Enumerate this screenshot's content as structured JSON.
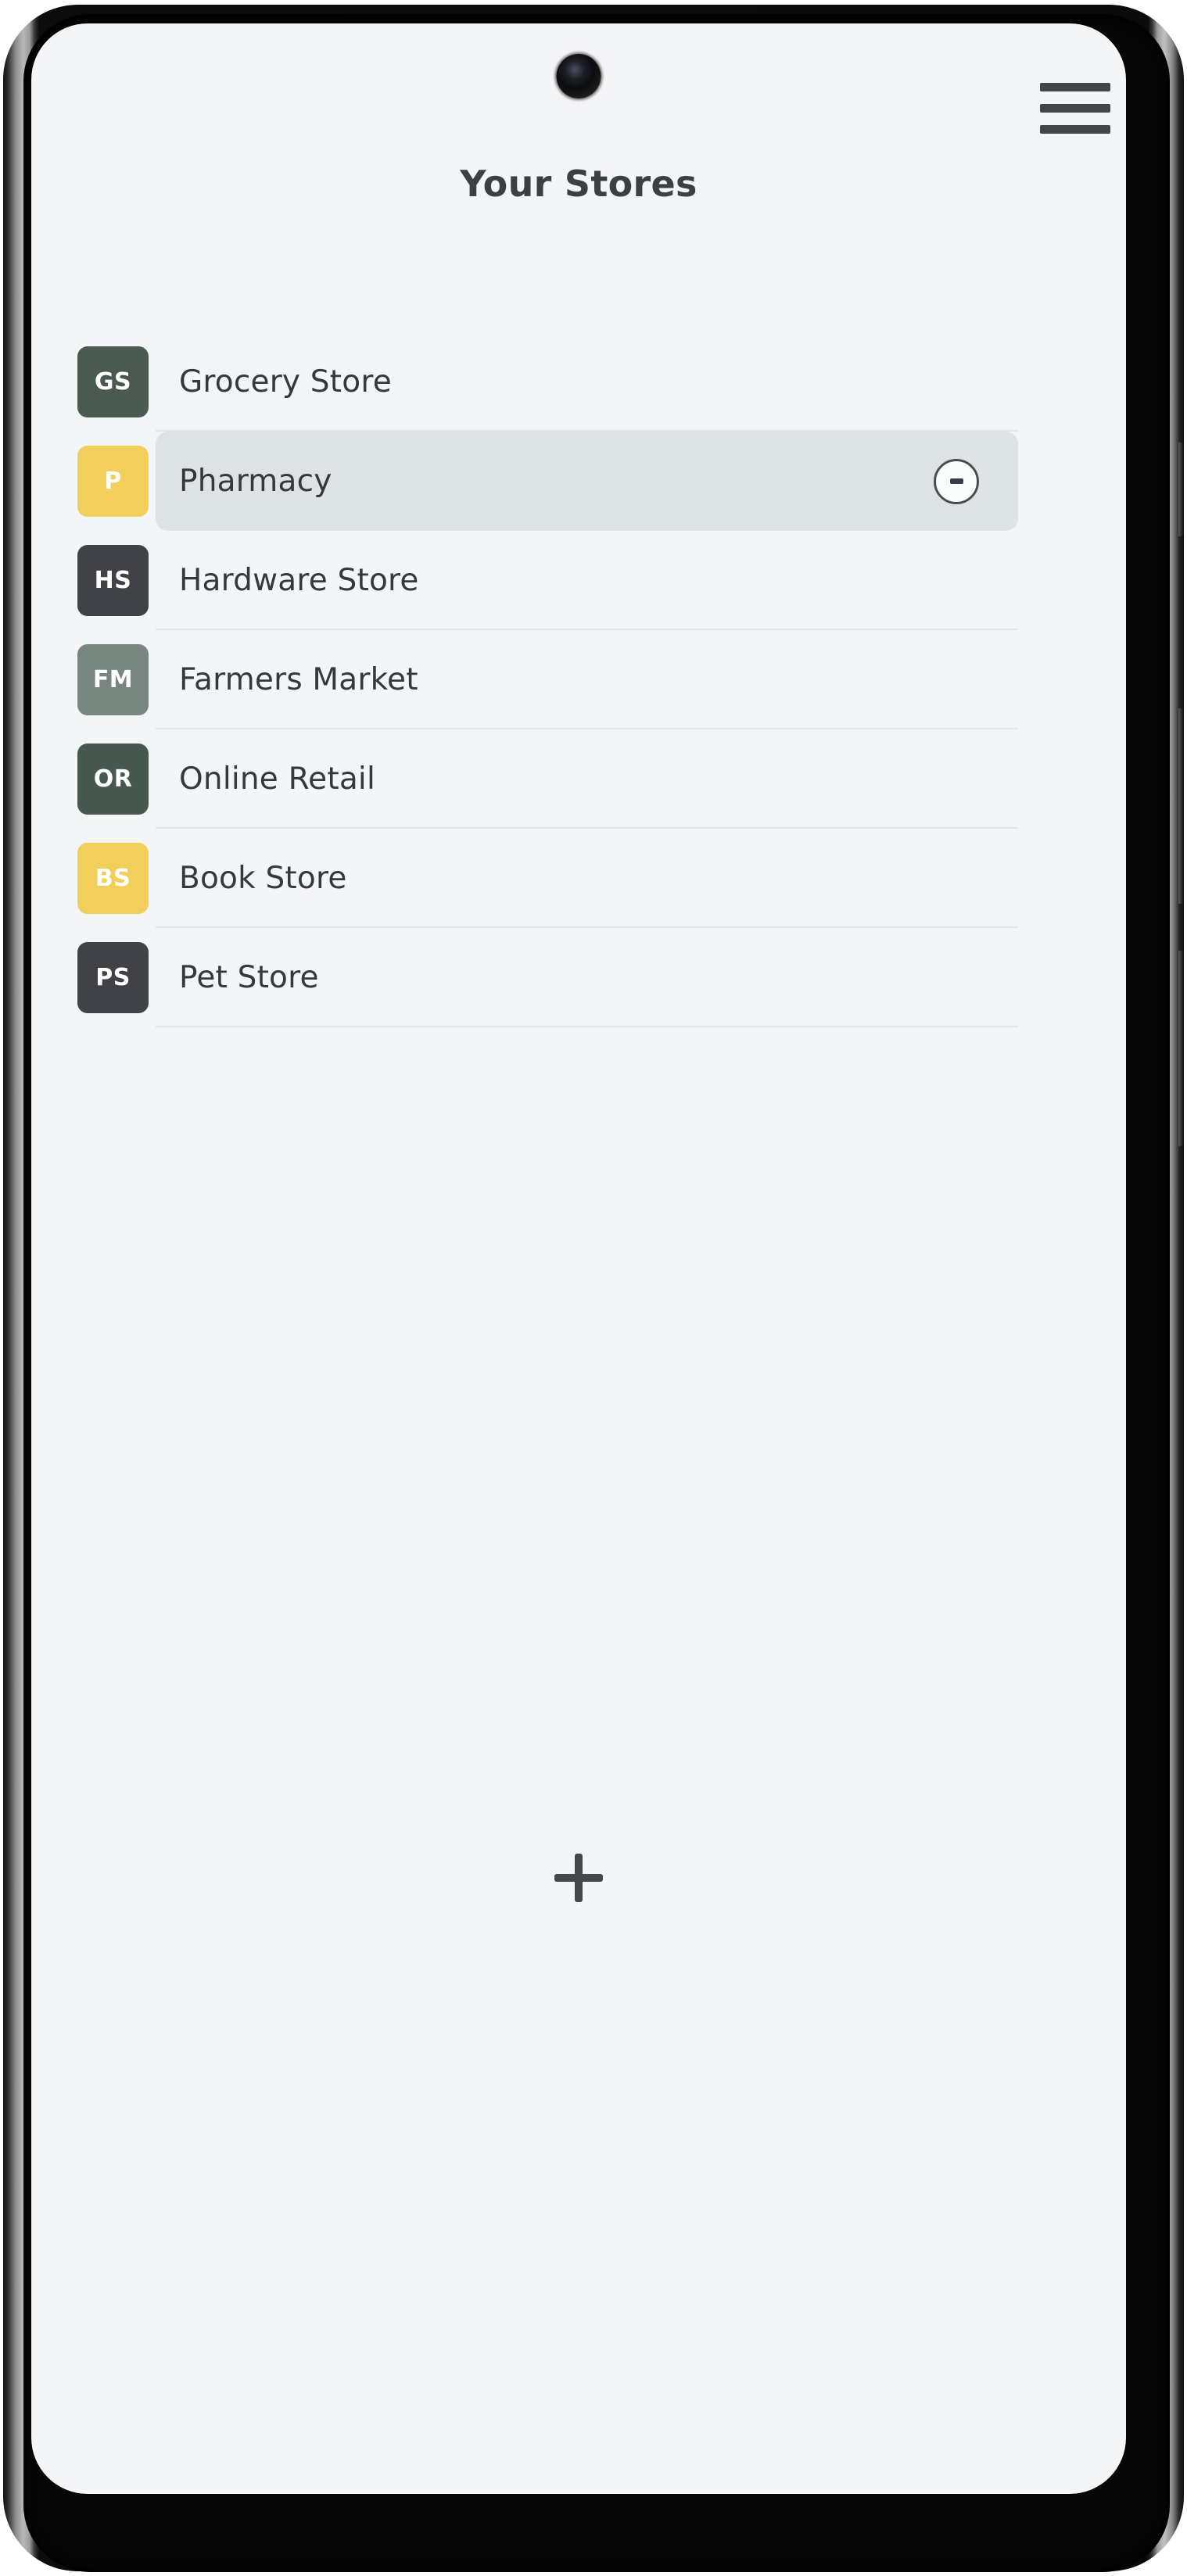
{
  "device": {
    "camera_icon": "front-camera",
    "side_buttons": [
      "volume-up",
      "volume-down",
      "power"
    ]
  },
  "header": {
    "title": "Your Stores",
    "menu_icon": "hamburger-menu-icon"
  },
  "stores": [
    {
      "initials": "GS",
      "name": "Grocery Store",
      "color": "#4a5a51",
      "selected": false
    },
    {
      "initials": "P",
      "name": "Pharmacy",
      "color": "#f2cf5b",
      "selected": true,
      "remove_icon": "minus-icon"
    },
    {
      "initials": "HS",
      "name": "Hardware Store",
      "color": "#404247",
      "selected": false
    },
    {
      "initials": "FM",
      "name": "Farmers Market",
      "color": "#77877f",
      "selected": false
    },
    {
      "initials": "OR",
      "name": "Online Retail",
      "color": "#47584e",
      "selected": false
    },
    {
      "initials": "BS",
      "name": "Book Store",
      "color": "#f2cf5b",
      "selected": false
    },
    {
      "initials": "PS",
      "name": "Pet Store",
      "color": "#404247",
      "selected": false
    }
  ],
  "add_button": {
    "icon": "plus-icon",
    "label": "+"
  },
  "colors": {
    "screen_background": "#f4f5f7",
    "selected_row_background": "#dde3e4",
    "divider": "#e2e6e7",
    "text_primary": "#35393d",
    "title": "#3c4044",
    "accent_yellow": "#f2cf5b",
    "accent_green": "#4a5a51"
  }
}
